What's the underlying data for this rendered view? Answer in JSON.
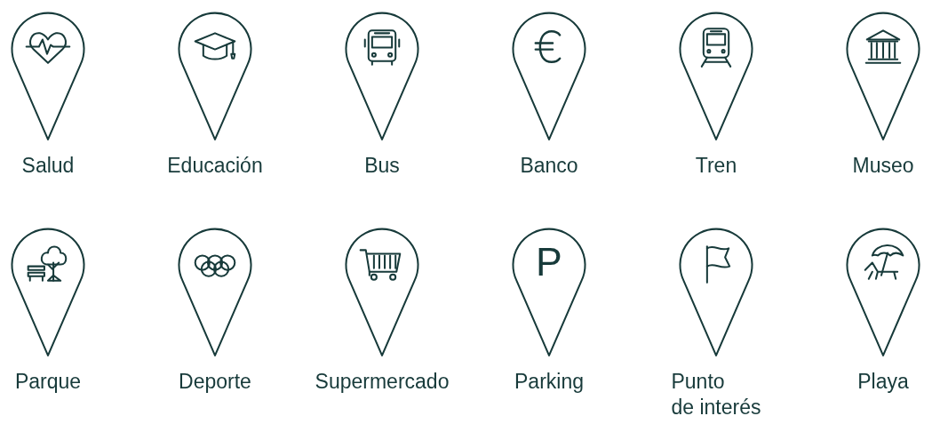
{
  "pins": [
    {
      "kind": "health",
      "label": "Salud"
    },
    {
      "kind": "education",
      "label": "Educación"
    },
    {
      "kind": "bus",
      "label": "Bus"
    },
    {
      "kind": "bank",
      "label": "Banco"
    },
    {
      "kind": "train",
      "label": "Tren"
    },
    {
      "kind": "museum",
      "label": "Museo"
    },
    {
      "kind": "park",
      "label": "Parque"
    },
    {
      "kind": "sport",
      "label": "Deporte"
    },
    {
      "kind": "supermarket",
      "label": "Supermercado"
    },
    {
      "kind": "parking",
      "glyph": "P",
      "label": "Parking"
    },
    {
      "kind": "poi",
      "label": "Punto\nde interés"
    },
    {
      "kind": "beach",
      "label": "Playa"
    }
  ]
}
